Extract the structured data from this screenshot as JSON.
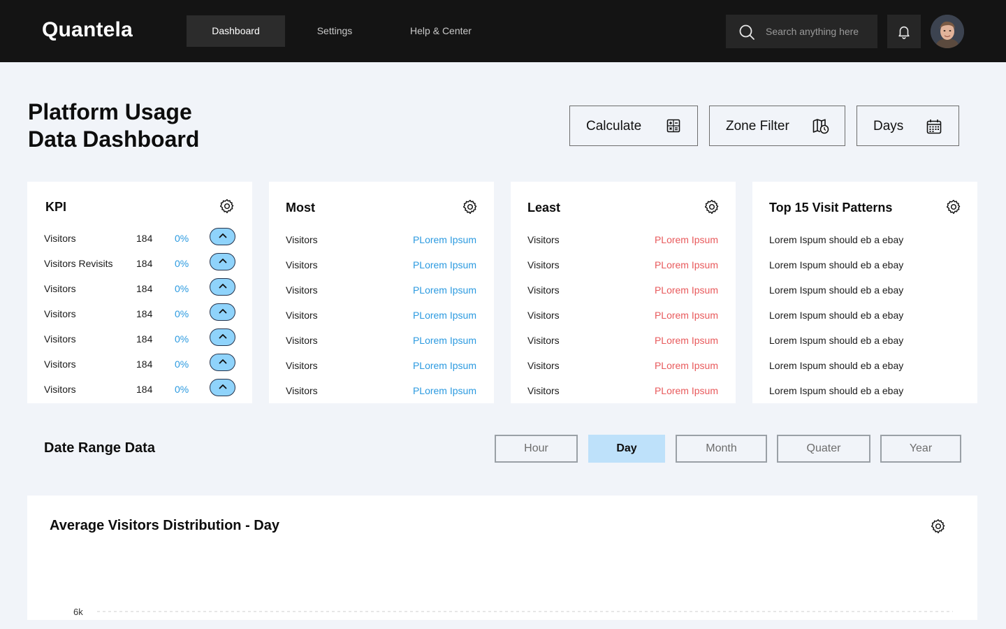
{
  "app": {
    "logo": "Quantela"
  },
  "nav": [
    {
      "label": "Dashboard",
      "active": true
    },
    {
      "label": "Settings",
      "active": false
    },
    {
      "label": "Help & Center",
      "active": false
    }
  ],
  "search": {
    "placeholder": "Search anything here"
  },
  "icons": {
    "search": "search-icon",
    "notifications": "bell-icon",
    "user": "avatar"
  },
  "header": {
    "title_line1": "Platform Usage",
    "title_line2": "Data Dashboard",
    "buttons": [
      {
        "label": "Calculate",
        "icon": "calculator-icon"
      },
      {
        "label": "Zone Filter",
        "icon": "map-clock-icon"
      },
      {
        "label": "Days",
        "icon": "calendar-icon"
      }
    ]
  },
  "kpi": {
    "title": "KPI",
    "rows": [
      {
        "label": "Visitors",
        "value": "184",
        "change": "0%"
      },
      {
        "label": "Visitors Revisits",
        "value": "184",
        "change": "0%"
      },
      {
        "label": "Visitors",
        "value": "184",
        "change": "0%"
      },
      {
        "label": "Visitors",
        "value": "184",
        "change": "0%"
      },
      {
        "label": "Visitors",
        "value": "184",
        "change": "0%"
      },
      {
        "label": "Visitors",
        "value": "184",
        "change": "0%"
      },
      {
        "label": "Visitors",
        "value": "184",
        "change": "0%"
      }
    ]
  },
  "most": {
    "title": "Most",
    "rows": [
      {
        "label": "Visitors",
        "value": "PLorem Ipsum"
      },
      {
        "label": "Visitors",
        "value": "PLorem Ipsum"
      },
      {
        "label": "Visitors",
        "value": "PLorem Ipsum"
      },
      {
        "label": "Visitors",
        "value": "PLorem Ipsum"
      },
      {
        "label": "Visitors",
        "value": "PLorem Ipsum"
      },
      {
        "label": "Visitors",
        "value": "PLorem Ipsum"
      },
      {
        "label": "Visitors",
        "value": "PLorem Ipsum"
      }
    ]
  },
  "least": {
    "title": "Least",
    "rows": [
      {
        "label": "Visitors",
        "value": "PLorem Ipsum"
      },
      {
        "label": "Visitors",
        "value": "PLorem Ipsum"
      },
      {
        "label": "Visitors",
        "value": "PLorem Ipsum"
      },
      {
        "label": "Visitors",
        "value": "PLorem Ipsum"
      },
      {
        "label": "Visitors",
        "value": "PLorem Ipsum"
      },
      {
        "label": "Visitors",
        "value": "PLorem Ipsum"
      },
      {
        "label": "Visitors",
        "value": "PLorem Ipsum"
      }
    ]
  },
  "patterns": {
    "title": "Top 15 Visit Patterns",
    "rows": [
      "Lorem Ispum should eb a ebay",
      "Lorem Ispum should eb a ebay",
      "Lorem Ispum should eb a ebay",
      "Lorem Ispum should eb a ebay",
      "Lorem Ispum should eb a ebay",
      "Lorem Ispum should eb a ebay",
      "Lorem Ispum should eb a ebay"
    ]
  },
  "date_range": {
    "title": "Date Range Data",
    "options": [
      {
        "label": "Hour",
        "active": false
      },
      {
        "label": "Day",
        "active": true
      },
      {
        "label": "Month",
        "active": false
      },
      {
        "label": "Quater",
        "active": false
      },
      {
        "label": "Year",
        "active": false
      }
    ]
  },
  "chart": {
    "title": "Average Visitors Distribution - Day",
    "y_tick_top": "6k"
  },
  "colors": {
    "topbar": "#141414",
    "accent_blue": "#2b9ae0",
    "accent_red": "#e8595b",
    "active_segment": "#bee1fa",
    "up_button": "#8fd3fb"
  }
}
